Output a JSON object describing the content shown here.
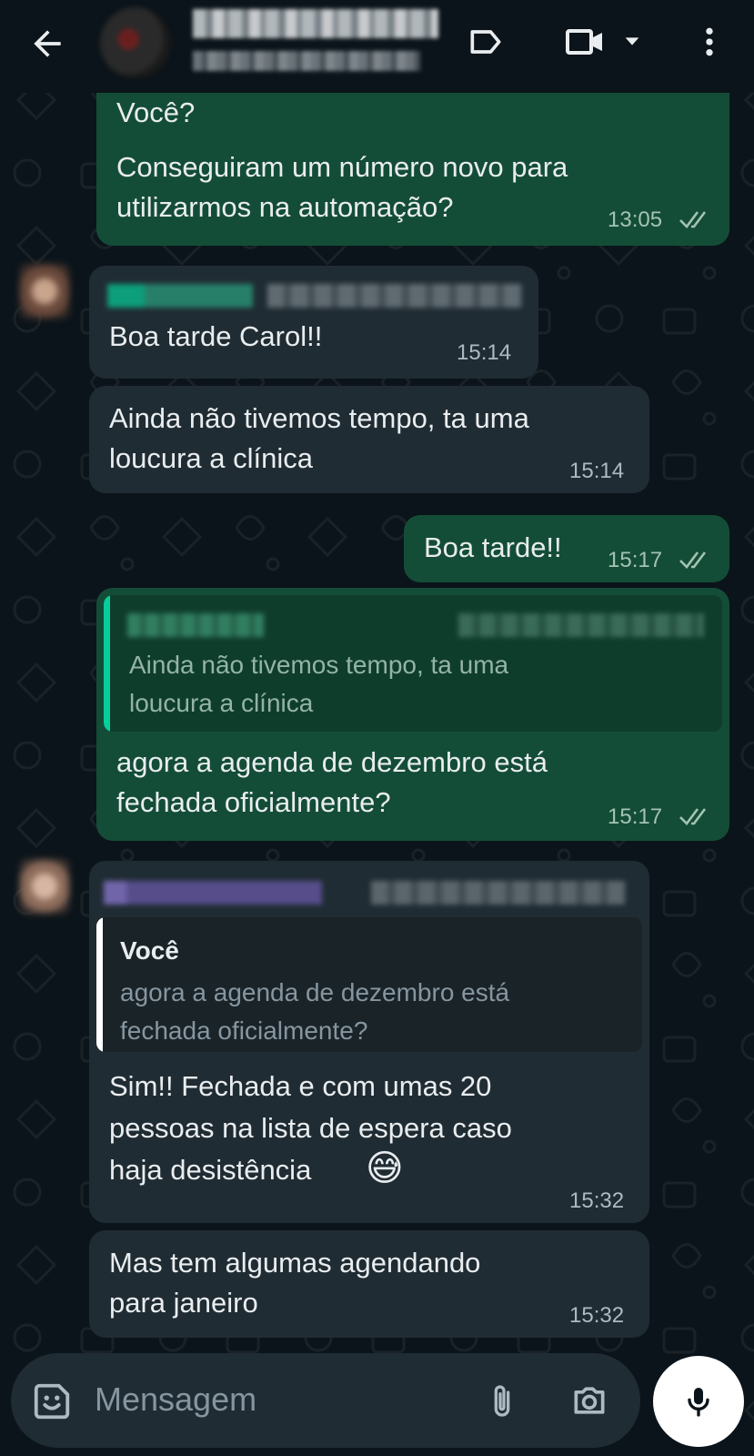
{
  "header": {
    "back_icon": "arrow-left-icon",
    "label_icon": "label-tag-icon",
    "video_icon": "video-camera-icon",
    "dropdown_icon": "chevron-down-icon",
    "menu_icon": "more-vert-icon"
  },
  "messages": [
    {
      "id": "m1",
      "direction": "outgoing",
      "partial_top": "Você?",
      "text_line1": "Conseguiram um número novo para",
      "text_line2": "utilizarmos na automação?",
      "time": "13:05",
      "status": "read"
    },
    {
      "id": "m2",
      "direction": "incoming",
      "text": "Boa tarde Carol!!",
      "time": "15:14"
    },
    {
      "id": "m3",
      "direction": "incoming",
      "text_line1": "Ainda não tivemos tempo, ta uma",
      "text_line2": "loucura a clínica",
      "time": "15:14"
    },
    {
      "id": "m4",
      "direction": "outgoing",
      "text": "Boa tarde!!",
      "time": "15:17",
      "status": "read"
    },
    {
      "id": "m5",
      "direction": "outgoing",
      "quote_line1": "Ainda não tivemos tempo, ta uma",
      "quote_line2": "loucura a clínica",
      "text_line1": "agora a agenda de dezembro está",
      "text_line2": "fechada oficialmente?",
      "time": "15:17",
      "status": "read"
    },
    {
      "id": "m6",
      "direction": "incoming",
      "quote_author": "Você",
      "quote_line1": "agora a agenda de dezembro está",
      "quote_line2": "fechada oficialmente?",
      "text_line1": "Sim!! Fechada e com umas 20",
      "text_line2": "pessoas na lista de espera caso",
      "text_line3": "haja desistência",
      "emoji": "😅",
      "time": "15:32"
    },
    {
      "id": "m7",
      "direction": "incoming",
      "text_line1": "Mas tem algumas agendando",
      "text_line2": "para janeiro",
      "time": "15:32"
    }
  ],
  "composer": {
    "placeholder": "Mensagem",
    "sticker_icon": "sticker-icon",
    "attach_icon": "paperclip-icon",
    "camera_icon": "camera-icon",
    "mic_icon": "microphone-icon"
  },
  "colors": {
    "background": "#0b141a",
    "outgoing_bubble": "#144d37",
    "incoming_bubble": "#202c33",
    "read_ticks": "#a3c3b3",
    "quote_bar_teal": "#06cf9c",
    "sender_purple": "#a78bfa",
    "sender_teal": "#06cf9c"
  }
}
